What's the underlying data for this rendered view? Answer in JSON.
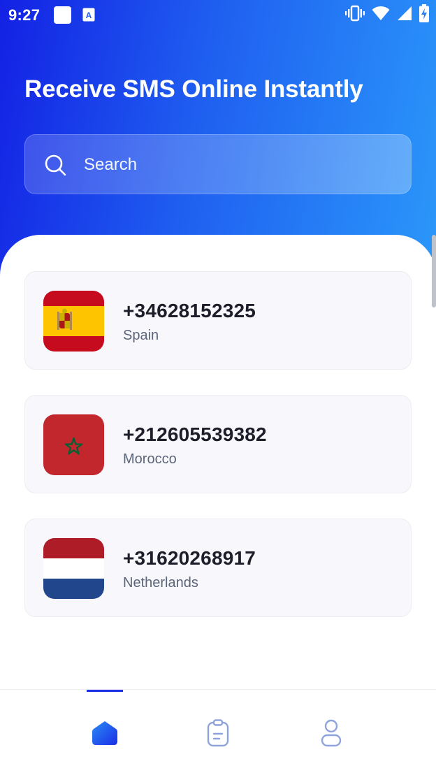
{
  "status_bar": {
    "time": "9:27",
    "icons": [
      "app-square-icon",
      "translate-a-icon",
      "vibrate-icon",
      "wifi-icon",
      "signal-icon",
      "battery-charging-icon"
    ]
  },
  "header": {
    "title": "Receive SMS Online Instantly"
  },
  "search": {
    "placeholder": "Search",
    "value": ""
  },
  "numbers": [
    {
      "phone": "+34628152325",
      "country": "Spain",
      "flag": "spain-flag-icon"
    },
    {
      "phone": "+212605539382",
      "country": "Morocco",
      "flag": "morocco-flag-icon"
    },
    {
      "phone": "+31620268917",
      "country": "Netherlands",
      "flag": "netherlands-flag-icon"
    }
  ],
  "bottom_nav": {
    "items": [
      {
        "icon": "home-icon",
        "active": true
      },
      {
        "icon": "clipboard-icon",
        "active": false
      },
      {
        "icon": "profile-icon",
        "active": false
      }
    ]
  },
  "colors": {
    "gradient_start": "#1321e4",
    "gradient_end": "#2b98fa",
    "accent": "#1a2ee6",
    "card_bg": "#f8f8fc",
    "inactive_icon": "#8fa3dc"
  }
}
